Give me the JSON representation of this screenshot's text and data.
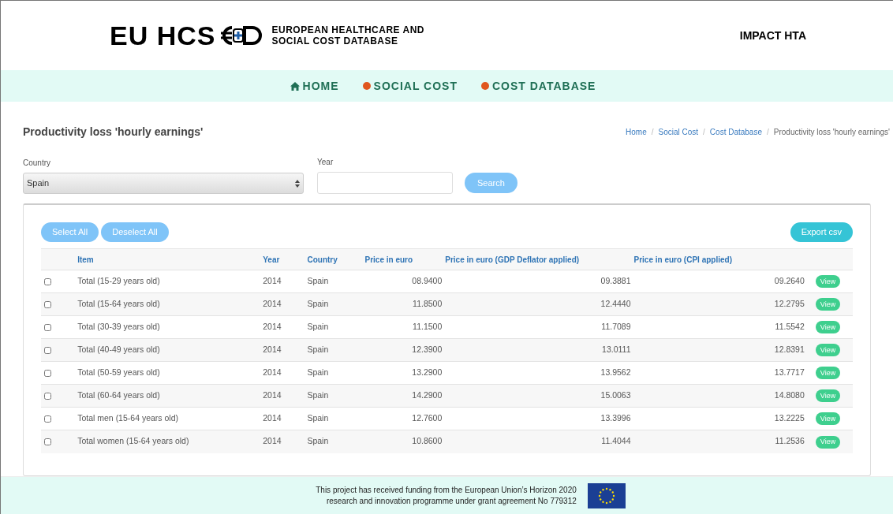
{
  "header": {
    "logo_text": "EU HCS",
    "logo_subtitle": [
      "EUROPEAN HEALTHCARE AND",
      "SOCIAL COST DATABASE"
    ],
    "partner_logo": "IMPACT HTA"
  },
  "nav": [
    {
      "label": "HOME",
      "kind": "home"
    },
    {
      "label": "SOCIAL COST",
      "kind": "dot"
    },
    {
      "label": "COST DATABASE",
      "kind": "dot"
    }
  ],
  "page_title": "Productivity loss 'hourly earnings'",
  "breadcrumb_separator": "/",
  "breadcrumb": [
    {
      "label": "Home",
      "kind": "link"
    },
    {
      "label": "Social Cost",
      "kind": "link"
    },
    {
      "label": "Cost Database",
      "kind": "link"
    },
    {
      "label": "Productivity loss 'hourly earnings'",
      "kind": "current"
    }
  ],
  "filters": {
    "country": {
      "label": "Country",
      "value": "Spain"
    },
    "year": {
      "label": "Year"
    },
    "search_button": "Search"
  },
  "toolbar": {
    "select_all": "Select All",
    "deselect_all": "Deselect All",
    "export": "Export csv"
  },
  "table": {
    "columns": [
      "Item",
      "Year",
      "Country",
      "Price in euro",
      "Price in euro (GDP Deflator applied)",
      "Price in euro (CPI applied)"
    ],
    "rows": [
      {
        "checked": false,
        "cells": [
          "Total (15-29 years old)",
          "2014",
          "Spain",
          "08.9400",
          "09.3881",
          "09.2640"
        ],
        "action": "View"
      },
      {
        "checked": false,
        "cells": [
          "Total (15-64 years old)",
          "2014",
          "Spain",
          "11.8500",
          "12.4440",
          "12.2795"
        ],
        "action": "View"
      },
      {
        "checked": false,
        "cells": [
          "Total (30-39 years old)",
          "2014",
          "Spain",
          "11.1500",
          "11.7089",
          "11.5542"
        ],
        "action": "View"
      },
      {
        "checked": false,
        "cells": [
          "Total (40-49 years old)",
          "2014",
          "Spain",
          "12.3900",
          "13.0111",
          "12.8391"
        ],
        "action": "View"
      },
      {
        "checked": false,
        "cells": [
          "Total (50-59 years old)",
          "2014",
          "Spain",
          "13.2900",
          "13.9562",
          "13.7717"
        ],
        "action": "View"
      },
      {
        "checked": false,
        "cells": [
          "Total (60-64 years old)",
          "2014",
          "Spain",
          "14.2900",
          "15.0063",
          "14.8080"
        ],
        "action": "View"
      },
      {
        "checked": false,
        "cells": [
          "Total men (15-64 years old)",
          "2014",
          "Spain",
          "12.7600",
          "13.3996",
          "13.2225"
        ],
        "action": "View"
      },
      {
        "checked": false,
        "cells": [
          "Total women (15-64 years old)",
          "2014",
          "Spain",
          "10.8600",
          "11.4044",
          "11.2536"
        ],
        "action": "View"
      }
    ]
  },
  "footer": {
    "text": [
      "This project has received funding from the European Union’s Horizon 2020",
      "research and innovation programme under grant agreement No 779312"
    ]
  }
}
